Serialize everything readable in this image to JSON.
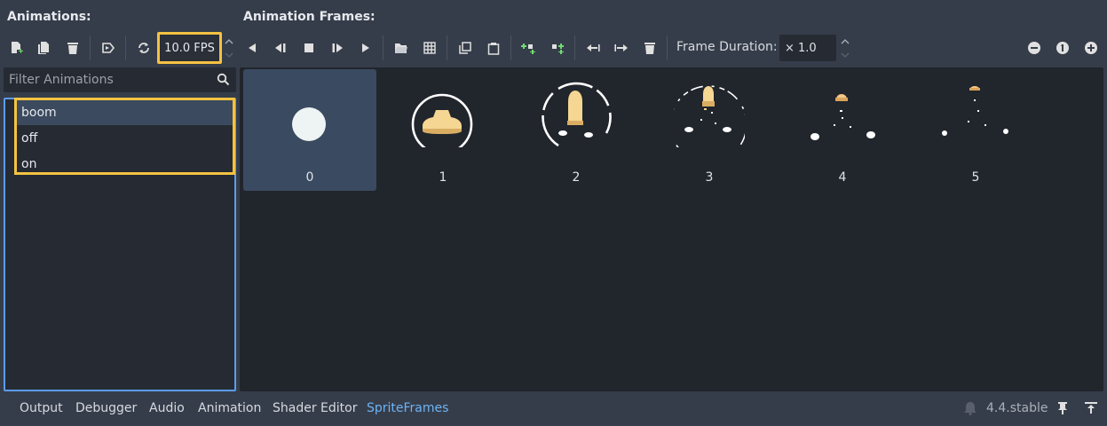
{
  "animations_header": "Animations:",
  "frames_header": "Animation Frames:",
  "fps": "10.0 FPS",
  "frame_duration_label": "Frame Duration:",
  "frame_duration_value": "× 1.0",
  "filter_placeholder": "Filter Animations",
  "animations": [
    "boom",
    "off",
    "on"
  ],
  "selected_animation": "boom",
  "frames": [
    "0",
    "1",
    "2",
    "3",
    "4",
    "5"
  ],
  "selected_frame": "0",
  "bottom_tabs": [
    "Output",
    "Debugger",
    "Audio",
    "Animation",
    "Shader Editor",
    "SpriteFrames"
  ],
  "active_tab": "SpriteFrames",
  "version": "4.4.stable",
  "colors": {
    "highlight": "#f5c242",
    "selection_border": "#5c9cf0",
    "active_tab": "#6cb4f5",
    "add_green": "#6fdc6f"
  }
}
